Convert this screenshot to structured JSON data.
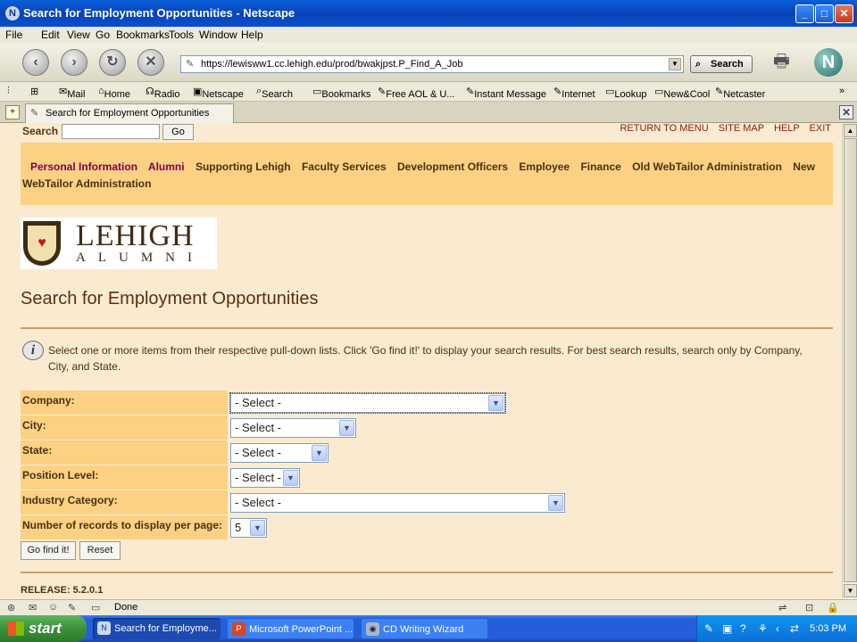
{
  "window": {
    "title": "Search for Employment Opportunities - Netscape"
  },
  "menubar": [
    "File",
    "Edit",
    "View",
    "Go",
    "Bookmarks",
    "Tools",
    "Window",
    "Help"
  ],
  "navbar": {
    "url": "https://lewisww1.cc.lehigh.edu/prod/bwakjpst.P_Find_A_Job",
    "search_label": "Search"
  },
  "personal_toolbar": [
    "Mail",
    "Home",
    "Radio",
    "Netscape",
    "Search",
    "Bookmarks",
    "Free AOL & U...",
    "Instant Message",
    "Internet",
    "Lookup",
    "New&Cool",
    "Netcaster"
  ],
  "tab": {
    "label": "Search for Employment Opportunities"
  },
  "page": {
    "search_label": "Search",
    "go_label": "Go",
    "top_links": [
      "RETURN TO MENU",
      "SITE MAP",
      "HELP",
      "EXIT"
    ],
    "menu_row1": [
      "Personal Information",
      "Alumni",
      "Supporting Lehigh",
      "Faculty Services",
      "Development Officers",
      "Employee",
      "Finance",
      "Old WebTailor Administration",
      "New"
    ],
    "menu_row2": "WebTailor Administration",
    "logo_word": "LEHIGH",
    "logo_sub": "ALUMNI",
    "title": "Search for Employment Opportunities",
    "info": "Select one or more items from their respective pull-down lists. Click 'Go find it!' to display your search results. For best search results, search only by Company, City, and State.",
    "form": {
      "company_label": "Company:",
      "company_value": "- Select -",
      "city_label": "City:",
      "city_value": "- Select -",
      "state_label": "State:",
      "state_value": "- Select -",
      "level_label": "Position Level:",
      "level_value": "- Select -",
      "industry_label": "Industry Category:",
      "industry_value": "- Select -",
      "records_label": "Number of records to display per page:",
      "records_value": "5"
    },
    "go_find_label": "Go find it!",
    "reset_label": "Reset",
    "release": "RELEASE: 5.2.0.1"
  },
  "status": {
    "text": "Done"
  },
  "taskbar": {
    "start": "start",
    "tasks": [
      "Search for Employme...",
      "Microsoft PowerPoint ...",
      "CD Writing Wizard"
    ],
    "time": "5:03 PM"
  }
}
